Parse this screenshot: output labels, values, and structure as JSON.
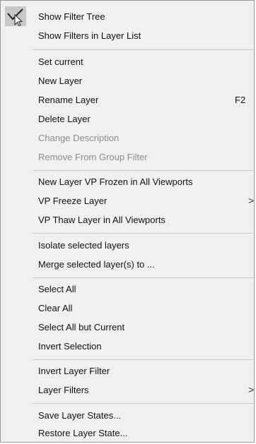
{
  "menu": {
    "check_icon": "checkmark-icon",
    "items": {
      "show_filter_tree": {
        "label": "Show Filter Tree"
      },
      "show_filters_in_layer_list": {
        "label": "Show Filters in Layer List"
      },
      "set_current": {
        "label": "Set current"
      },
      "new_layer": {
        "label": "New Layer"
      },
      "rename_layer": {
        "label": "Rename Layer",
        "shortcut": "F2"
      },
      "delete_layer": {
        "label": "Delete Layer"
      },
      "change_description": {
        "label": "Change Description",
        "disabled": true
      },
      "remove_from_group_filter": {
        "label": "Remove From Group Filter",
        "disabled": true
      },
      "new_layer_vp_frozen": {
        "label": "New Layer VP Frozen in All Viewports"
      },
      "vp_freeze_layer": {
        "label": "VP Freeze Layer",
        "submenu_arrow": ">"
      },
      "vp_thaw_layer": {
        "label": "VP Thaw Layer in All Viewports"
      },
      "isolate_selected_layers": {
        "label": "Isolate selected layers"
      },
      "merge_selected_layers": {
        "label": "Merge selected layer(s) to ..."
      },
      "select_all": {
        "label": "Select All"
      },
      "clear_all": {
        "label": "Clear All"
      },
      "select_all_but_current": {
        "label": "Select All but Current"
      },
      "invert_selection": {
        "label": "Invert Selection"
      },
      "invert_layer_filter": {
        "label": "Invert Layer Filter"
      },
      "layer_filters": {
        "label": "Layer Filters",
        "submenu_arrow": ">"
      },
      "save_layer_states": {
        "label": "Save Layer States..."
      },
      "restore_layer_state": {
        "label": "Restore Layer State..."
      }
    }
  }
}
